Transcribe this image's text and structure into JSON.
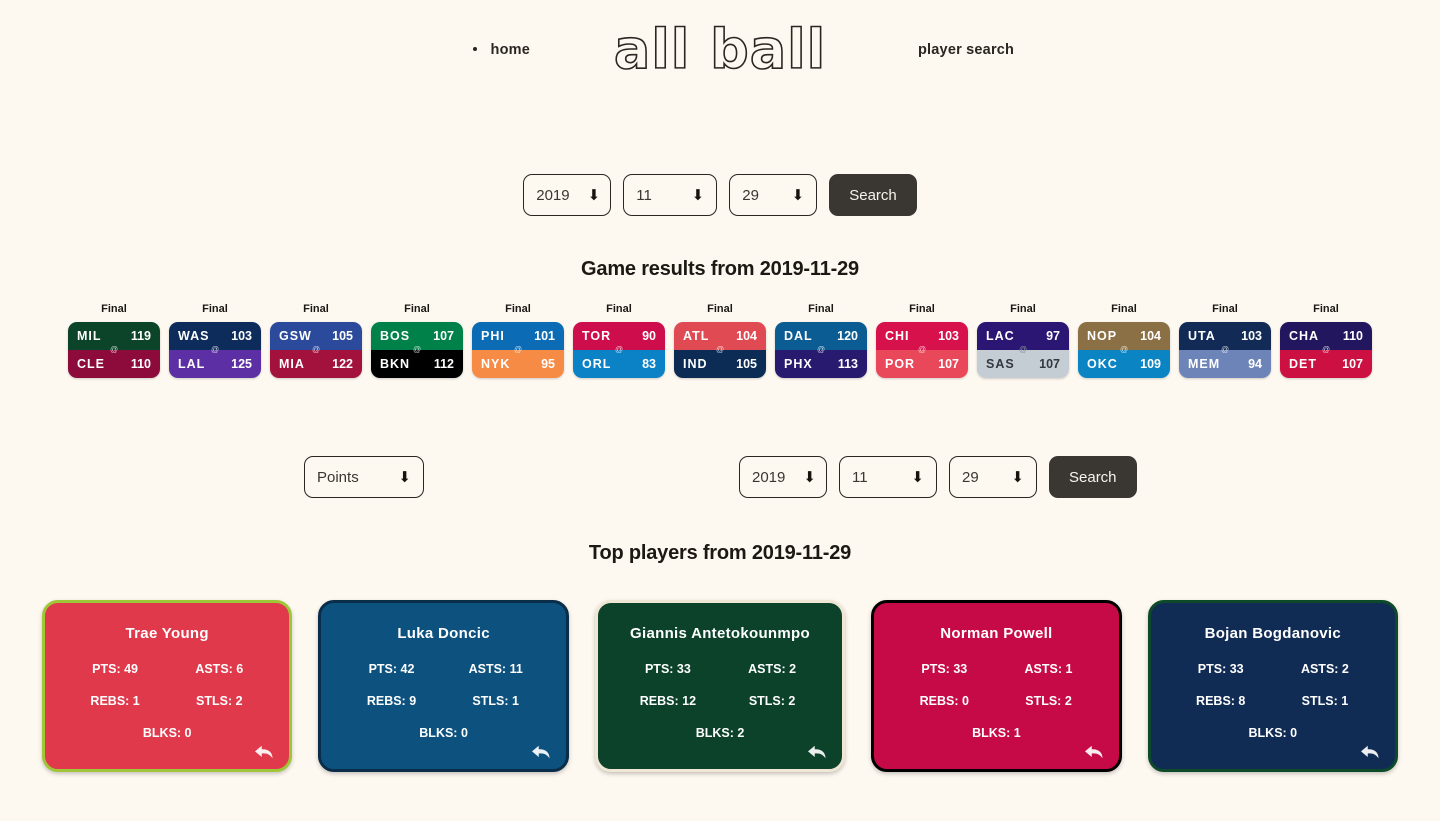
{
  "nav": {
    "home_label": "home",
    "brand": "all ball",
    "player_search_label": "player search"
  },
  "game_search": {
    "year": "2019",
    "month": "11",
    "day": "29",
    "search_label": "Search",
    "arrow_glyph": "⬇"
  },
  "games_section": {
    "title": "Game results from 2019-11-29",
    "games": [
      {
        "status": "Final",
        "away": {
          "abbr": "MIL",
          "score": "119",
          "bg": "#0c4429",
          "fg": "#ffffff"
        },
        "home": {
          "abbr": "CLE",
          "score": "110",
          "bg": "#8c0b3b",
          "fg": "#ffffff"
        }
      },
      {
        "status": "Final",
        "away": {
          "abbr": "WAS",
          "score": "103",
          "bg": "#0d2c5c",
          "fg": "#ffffff"
        },
        "home": {
          "abbr": "LAL",
          "score": "125",
          "bg": "#5c30a4",
          "fg": "#ffffff"
        }
      },
      {
        "status": "Final",
        "away": {
          "abbr": "GSW",
          "score": "105",
          "bg": "#2b4a9b",
          "fg": "#ffffff"
        },
        "home": {
          "abbr": "MIA",
          "score": "122",
          "bg": "#a2123c",
          "fg": "#ffffff"
        }
      },
      {
        "status": "Final",
        "away": {
          "abbr": "BOS",
          "score": "107",
          "bg": "#00814a",
          "fg": "#ffffff"
        },
        "home": {
          "abbr": "BKN",
          "score": "112",
          "bg": "#000000",
          "fg": "#ffffff"
        }
      },
      {
        "status": "Final",
        "away": {
          "abbr": "PHI",
          "score": "101",
          "bg": "#0b6cb5",
          "fg": "#ffffff"
        },
        "home": {
          "abbr": "NYK",
          "score": "95",
          "bg": "#f58b45",
          "fg": "#ffffff"
        }
      },
      {
        "status": "Final",
        "away": {
          "abbr": "TOR",
          "score": "90",
          "bg": "#ce0e4c",
          "fg": "#ffffff"
        },
        "home": {
          "abbr": "ORL",
          "score": "83",
          "bg": "#0b81c6",
          "fg": "#ffffff"
        }
      },
      {
        "status": "Final",
        "away": {
          "abbr": "ATL",
          "score": "104",
          "bg": "#e04a52",
          "fg": "#ffffff"
        },
        "home": {
          "abbr": "IND",
          "score": "105",
          "bg": "#0d2c55",
          "fg": "#ffffff"
        }
      },
      {
        "status": "Final",
        "away": {
          "abbr": "DAL",
          "score": "120",
          "bg": "#0a5c93",
          "fg": "#ffffff"
        },
        "home": {
          "abbr": "PHX",
          "score": "113",
          "bg": "#281a6e",
          "fg": "#ffffff"
        }
      },
      {
        "status": "Final",
        "away": {
          "abbr": "CHI",
          "score": "103",
          "bg": "#d6114c",
          "fg": "#ffffff"
        },
        "home": {
          "abbr": "POR",
          "score": "107",
          "bg": "#e8485a",
          "fg": "#ffffff"
        }
      },
      {
        "status": "Final",
        "away": {
          "abbr": "LAC",
          "score": "97",
          "bg": "#2b1773",
          "fg": "#ffffff"
        },
        "home": {
          "abbr": "SAS",
          "score": "107",
          "bg": "#c4ccd4",
          "fg": "#33393f"
        }
      },
      {
        "status": "Final",
        "away": {
          "abbr": "NOP",
          "score": "104",
          "bg": "#8a7044",
          "fg": "#ffffff"
        },
        "home": {
          "abbr": "OKC",
          "score": "109",
          "bg": "#0b84c4",
          "fg": "#ffffff"
        }
      },
      {
        "status": "Final",
        "away": {
          "abbr": "UTA",
          "score": "103",
          "bg": "#112b56",
          "fg": "#ffffff"
        },
        "home": {
          "abbr": "MEM",
          "score": "94",
          "bg": "#6c84b8",
          "fg": "#ffffff"
        }
      },
      {
        "status": "Final",
        "away": {
          "abbr": "CHA",
          "score": "110",
          "bg": "#22165e",
          "fg": "#ffffff"
        },
        "home": {
          "abbr": "DET",
          "score": "107",
          "bg": "#cc1041",
          "fg": "#ffffff"
        }
      }
    ]
  },
  "player_search": {
    "stat": "Points",
    "year": "2019",
    "month": "11",
    "day": "29",
    "search_label": "Search",
    "arrow_glyph": "⬇"
  },
  "players_section": {
    "title": "Top players from 2019-11-29",
    "labels": {
      "pts": "PTS",
      "asts": "ASTS",
      "rebs": "REBS",
      "stls": "STLS",
      "blks": "BLKS"
    },
    "players": [
      {
        "name": "Trae Young",
        "pts": "PTS: 49",
        "asts": "ASTS: 6",
        "rebs": "REBS: 1",
        "stls": "STLS: 2",
        "blks": "BLKS: 0",
        "bg": "#e0394b",
        "border": "#9fc538"
      },
      {
        "name": "Luka Doncic",
        "pts": "PTS: 42",
        "asts": "ASTS: 11",
        "rebs": "REBS: 9",
        "stls": "STLS: 1",
        "blks": "BLKS: 0",
        "bg": "#0d527f",
        "border": "#0a2d4a"
      },
      {
        "name": "Giannis Antetokounmpo",
        "pts": "PTS: 33",
        "asts": "ASTS: 2",
        "rebs": "REBS: 12",
        "stls": "STLS: 2",
        "blks": "BLKS: 2",
        "bg": "#0b4229",
        "border": "#efe6d6"
      },
      {
        "name": "Norman Powell",
        "pts": "PTS: 33",
        "asts": "ASTS: 1",
        "rebs": "REBS: 0",
        "stls": "STLS: 2",
        "blks": "BLKS: 1",
        "bg": "#c60a48",
        "border": "#000000"
      },
      {
        "name": "Bojan Bogdanovic",
        "pts": "PTS: 33",
        "asts": "ASTS: 2",
        "rebs": "REBS: 8",
        "stls": "STLS: 1",
        "blks": "BLKS: 0",
        "bg": "#112c54",
        "border": "#0c4a2a"
      }
    ]
  },
  "icons": {
    "at_symbol": "@",
    "back_arrow": "back-arrow-icon"
  }
}
